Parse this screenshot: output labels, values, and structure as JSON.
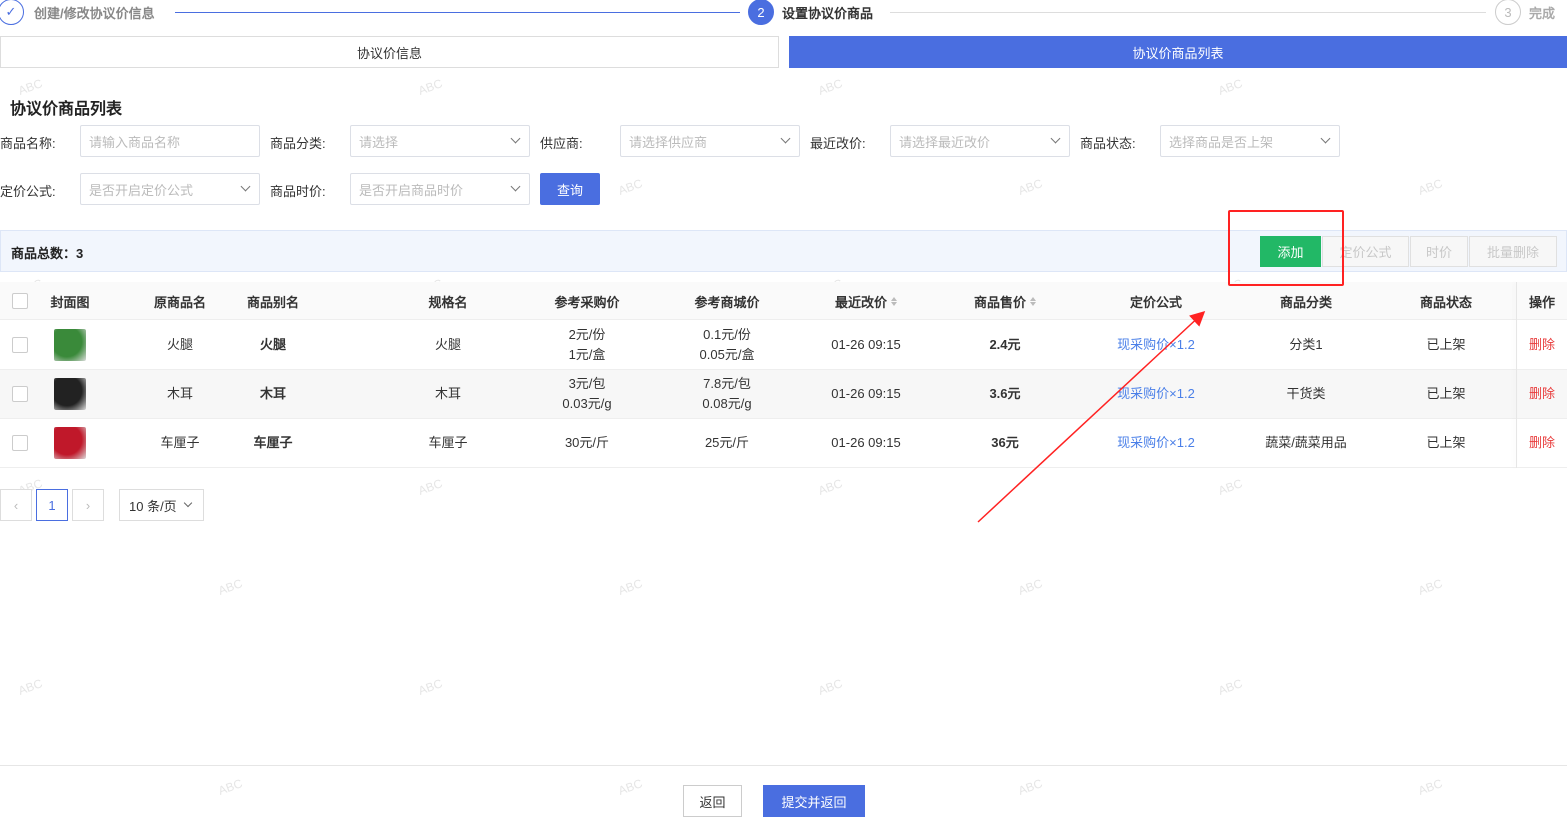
{
  "steps": [
    {
      "num": "✓",
      "label": "创建/修改协议价信息"
    },
    {
      "num": "2",
      "label": "设置协议价商品"
    },
    {
      "num": "3",
      "label": "完成"
    }
  ],
  "tabs": [
    {
      "label": "协议价信息"
    },
    {
      "label": "协议价商品列表"
    }
  ],
  "section_title": "协议价商品列表",
  "filters": {
    "name_label": "商品名称:",
    "name_placeholder": "请输入商品名称",
    "category_label": "商品分类:",
    "category_placeholder": "请选择",
    "supplier_label": "供应商:",
    "supplier_placeholder": "请选择供应商",
    "recent_label": "最近改价:",
    "recent_placeholder": "请选择最近改价",
    "status_label": "商品状态:",
    "status_placeholder": "选择商品是否上架",
    "formula_label": "定价公式:",
    "formula_placeholder": "是否开启定价公式",
    "time_label": "商品时价:",
    "time_placeholder": "是否开启商品时价",
    "query_label": "查询"
  },
  "toolbar": {
    "total": "商品总数：3",
    "add": "添加",
    "formula": "定价公式",
    "time_price": "时价",
    "batch_delete": "批量删除"
  },
  "columns": [
    "封面图",
    "原商品名",
    "商品别名",
    "规格名",
    "参考采购价",
    "参考商城价",
    "最近改价",
    "商品售价",
    "定价公式",
    "商品分类",
    "商品状态",
    "操作"
  ],
  "rows": [
    {
      "name": "火腿",
      "alias": "火腿",
      "spec": "火腿",
      "buy1": "2元/份",
      "buy2": "1元/盒",
      "mall1": "0.1元/份",
      "mall2": "0.05元/盒",
      "updated": "01-26 09:15",
      "price": "2.4元",
      "formula": "现采购价×1.2",
      "category": "分类1",
      "status": "已上架",
      "action": "删除",
      "thumb_color": "#3a8a3a"
    },
    {
      "name": "木耳",
      "alias": "木耳",
      "spec": "木耳",
      "buy1": "3元/包",
      "buy2": "0.03元/g",
      "mall1": "7.8元/包",
      "mall2": "0.08元/g",
      "updated": "01-26 09:15",
      "price": "3.6元",
      "formula": "现采购价×1.2",
      "category": "干货类",
      "status": "已上架",
      "action": "删除",
      "thumb_color": "#222222"
    },
    {
      "name": "车厘子",
      "alias": "车厘子",
      "spec": "车厘子",
      "buy1": "30元/斤",
      "buy2": "",
      "mall1": "25元/斤",
      "mall2": "",
      "updated": "01-26 09:15",
      "price": "36元",
      "formula": "现采购价×1.2",
      "category": "蔬菜/蔬菜用品",
      "status": "已上架",
      "action": "删除",
      "thumb_color": "#c0182a"
    }
  ],
  "pagination": {
    "current": "1",
    "page_size": "10 条/页"
  },
  "footer": {
    "back": "返回",
    "submit": "提交并返回"
  },
  "watermark": "ABC",
  "colors": {
    "primary": "#4a6ee0",
    "add": "#22b866",
    "danger": "#e83a3a",
    "annotation": "#ff2222"
  }
}
